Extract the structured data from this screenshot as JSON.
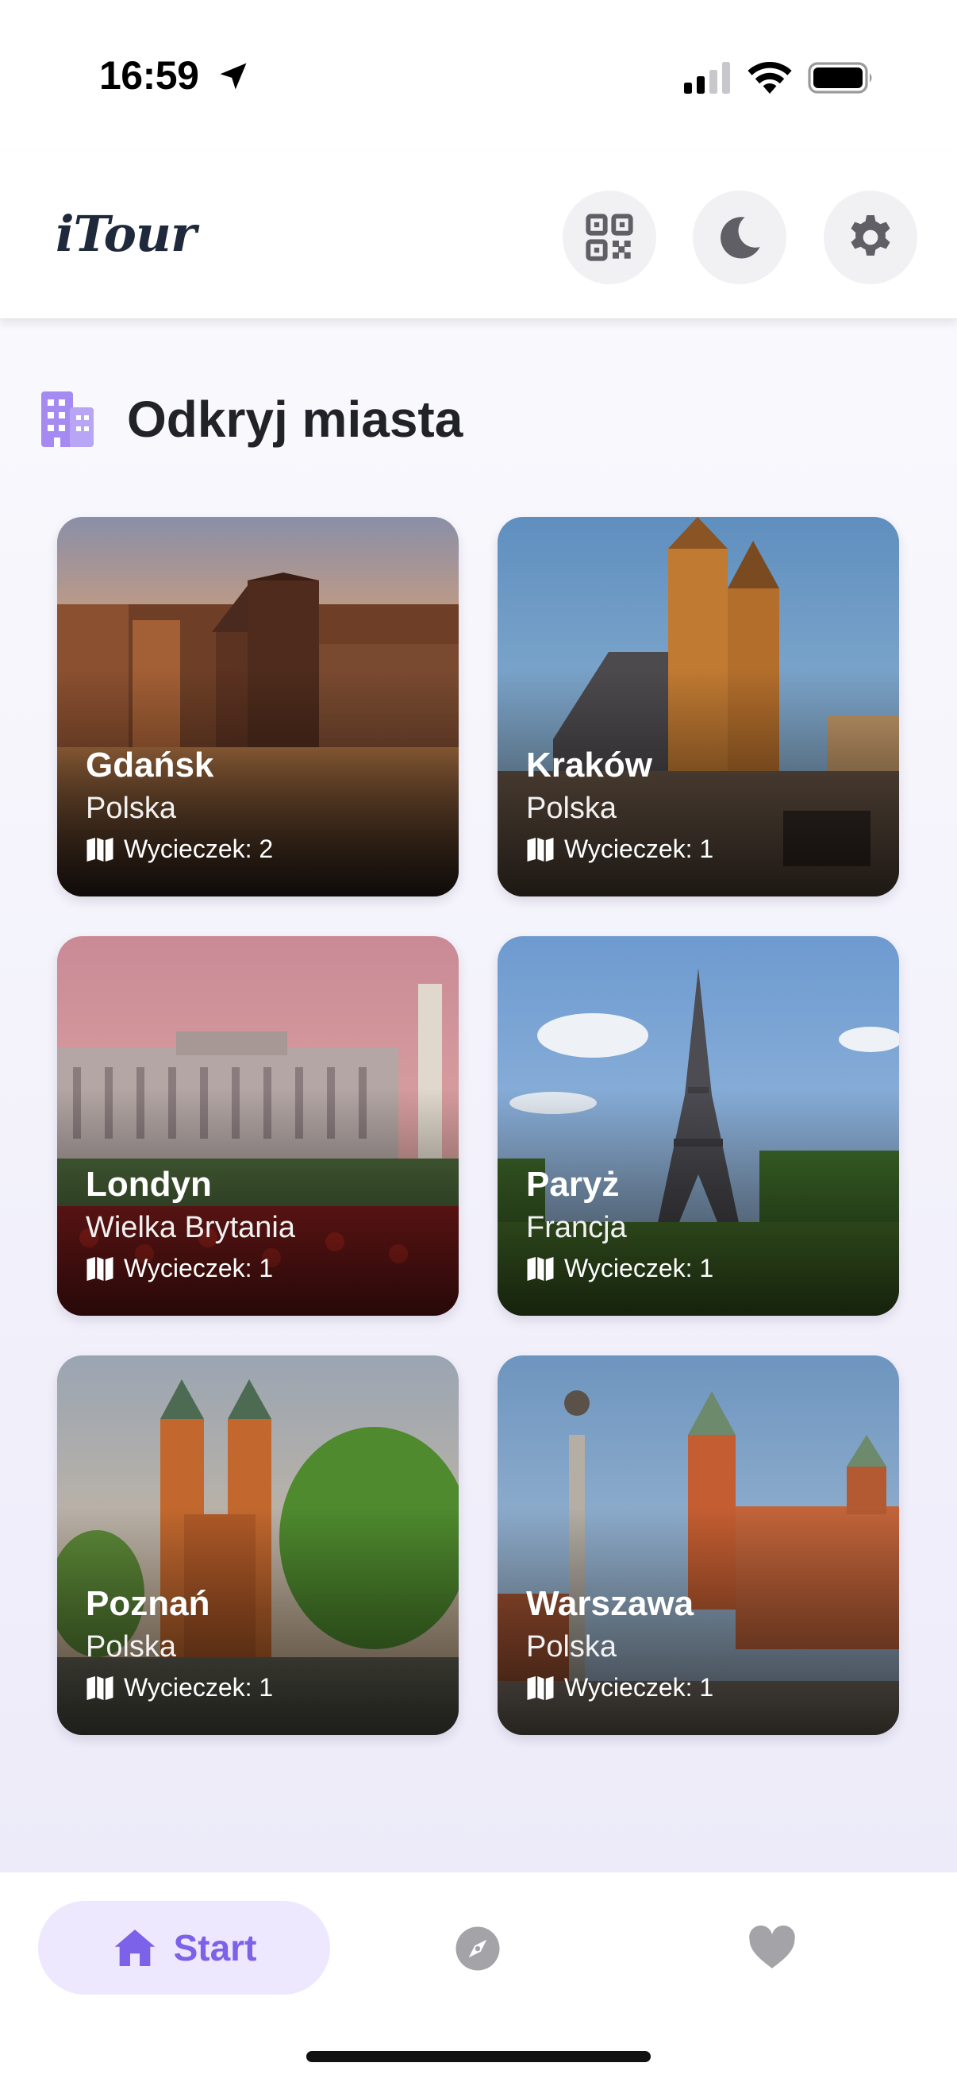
{
  "status_bar": {
    "time": "16:59",
    "icons": [
      "location-arrow-icon",
      "cellular-signal-icon",
      "wifi-icon",
      "battery-icon"
    ]
  },
  "header": {
    "logo": "iTour",
    "buttons": [
      "qr-code-icon",
      "moon-icon",
      "gear-icon"
    ]
  },
  "section": {
    "title": "Odkryj miasta",
    "icon": "building-icon",
    "accent_color": "#9b7cf0"
  },
  "cities": [
    {
      "name": "Gdańsk",
      "country": "Polska",
      "tours": "Wycieczek: 2"
    },
    {
      "name": "Kraków",
      "country": "Polska",
      "tours": "Wycieczek: 1"
    },
    {
      "name": "Londyn",
      "country": "Wielka Brytania",
      "tours": "Wycieczek: 1"
    },
    {
      "name": "Paryż",
      "country": "Francja",
      "tours": "Wycieczek: 1"
    },
    {
      "name": "Poznań",
      "country": "Polska",
      "tours": "Wycieczek: 1"
    },
    {
      "name": "Warszawa",
      "country": "Polska",
      "tours": "Wycieczek: 1"
    }
  ],
  "bottom_nav": {
    "items": [
      {
        "label": "Start",
        "icon": "home-icon",
        "active": true
      },
      {
        "label": "",
        "icon": "compass-icon",
        "active": false
      },
      {
        "label": "",
        "icon": "heart-icon",
        "active": false
      }
    ],
    "active_color": "#7b62e8",
    "inactive_color": "#a3a3a8"
  }
}
